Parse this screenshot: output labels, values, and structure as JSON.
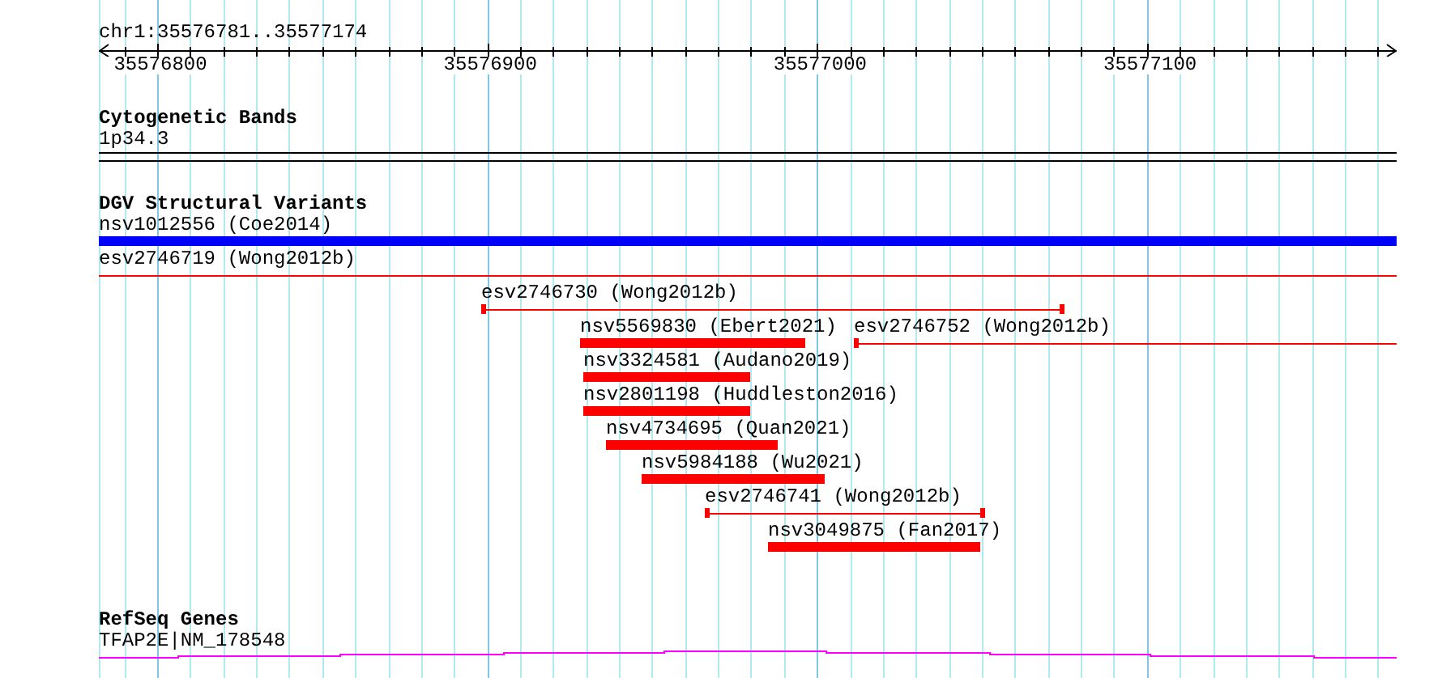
{
  "ruler": {
    "title": "chr1:35576781..35577174",
    "ticks": [
      "35576800",
      "35576900",
      "35577000",
      "35577100"
    ]
  },
  "tracks": [
    {
      "title": "Cytogenetic Bands",
      "kind": "cytoband",
      "features": [
        {
          "label": "1p34.3"
        }
      ]
    },
    {
      "title": "DGV Structural Variants",
      "kind": "variants",
      "features": [
        {
          "label": "nsv1012556 (Coe2014)",
          "kind": "bar",
          "color": "#0000ff"
        },
        {
          "label": "esv2746719 (Wong2012b)",
          "kind": "line",
          "color": "#ff0000"
        },
        {
          "label": "esv2746730 (Wong2012b)",
          "kind": "line",
          "color": "#ff0000"
        },
        {
          "label": "nsv5569830 (Ebert2021)",
          "kind": "bar",
          "color": "#ff0000"
        },
        {
          "label": "esv2746752 (Wong2012b)",
          "kind": "line",
          "color": "#ff0000"
        },
        {
          "label": "nsv3324581 (Audano2019)",
          "kind": "bar",
          "color": "#ff0000"
        },
        {
          "label": "nsv2801198 (Huddleston2016)",
          "kind": "bar",
          "color": "#ff0000"
        },
        {
          "label": "nsv4734695 (Quan2021)",
          "kind": "bar",
          "color": "#ff0000"
        },
        {
          "label": "nsv5984188 (Wu2021)",
          "kind": "bar",
          "color": "#ff0000"
        },
        {
          "label": "esv2746741 (Wong2012b)",
          "kind": "line",
          "color": "#ff0000"
        },
        {
          "label": "nsv3049875 (Fan2017)",
          "kind": "bar",
          "color": "#ff0000"
        }
      ]
    },
    {
      "title": "RefSeq Genes",
      "kind": "gene",
      "features": [
        {
          "label": "TFAP2E|NM_178548"
        }
      ]
    }
  ]
}
